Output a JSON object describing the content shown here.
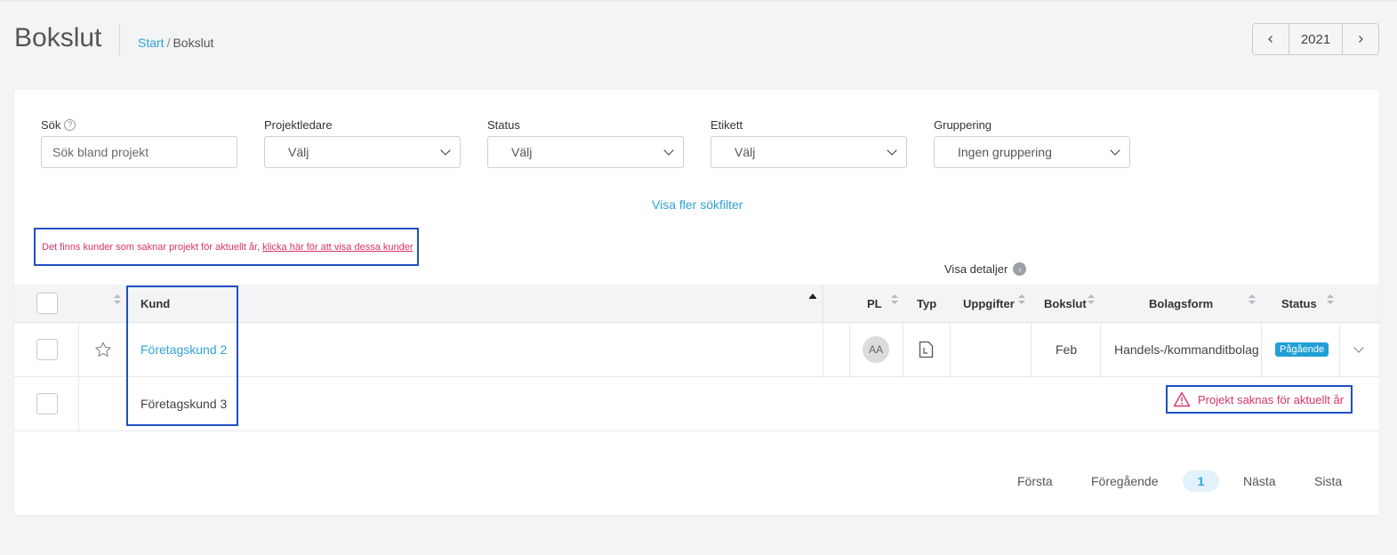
{
  "header": {
    "title": "Bokslut",
    "breadcrumb": {
      "start": "Start",
      "separator": "/",
      "current": "Bokslut"
    }
  },
  "year_nav": {
    "year": "2021",
    "prev_icon": "chevron-left-icon",
    "next_icon": "chevron-right-icon"
  },
  "filters": {
    "search": {
      "label": "Sök",
      "placeholder": "Sök bland projekt",
      "help_icon": "?"
    },
    "projektledare": {
      "label": "Projektledare",
      "value": "Välj"
    },
    "status": {
      "label": "Status",
      "value": "Välj"
    },
    "etikett": {
      "label": "Etikett",
      "value": "Välj"
    },
    "gruppering": {
      "label": "Gruppering",
      "value": "Ingen gruppering"
    },
    "more_filters": "Visa fler sökfilter"
  },
  "notice": {
    "text": "Det finns kunder som saknar projekt för aktuellt år,",
    "link": "klicka här för att visa dessa kunder"
  },
  "details_toggle": {
    "label": "Visa detaljer",
    "icon": "‹"
  },
  "table": {
    "columns": {
      "kund": "Kund",
      "pl": "PL",
      "typ": "Typ",
      "uppgifter": "Uppgifter",
      "bokslut": "Bokslut",
      "bolagsform": "Bolagsform",
      "status": "Status"
    },
    "rows": [
      {
        "kund": "Företagskund 2",
        "pl": "AA",
        "typ_icon": "document-icon",
        "uppgifter": "",
        "bokslut": "Feb",
        "bolagsform": "Handels-/kommanditbolag",
        "status": "Pågående"
      },
      {
        "kund": "Företagskund 3",
        "warning": "Projekt saknas för aktuellt år"
      }
    ]
  },
  "pagination": {
    "first": "Första",
    "prev": "Föregående",
    "current": "1",
    "next": "Nästa",
    "last": "Sista"
  },
  "colors": {
    "accent": "#2ea2d6",
    "warning": "#d8336a",
    "highlight_border": "#1f4fc1",
    "status_badge": "#1f9fd6"
  }
}
